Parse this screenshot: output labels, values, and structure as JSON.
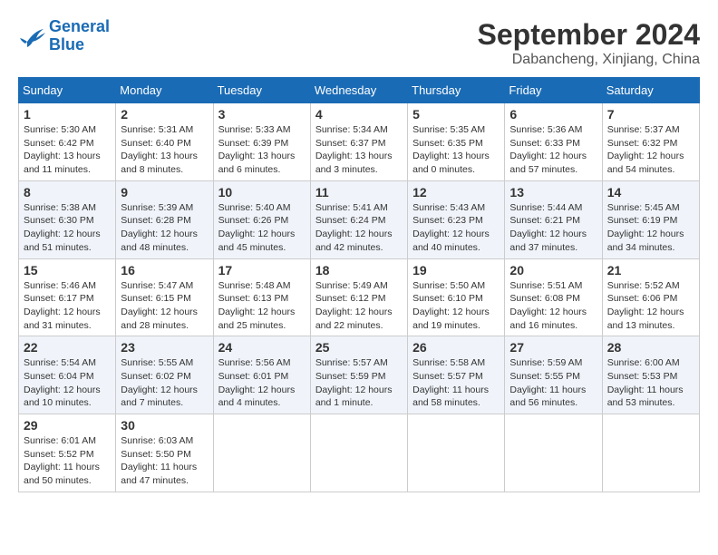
{
  "logo": {
    "line1": "General",
    "line2": "Blue"
  },
  "title": "September 2024",
  "location": "Dabancheng, Xinjiang, China",
  "weekdays": [
    "Sunday",
    "Monday",
    "Tuesday",
    "Wednesday",
    "Thursday",
    "Friday",
    "Saturday"
  ],
  "weeks": [
    [
      {
        "day": "1",
        "info": "Sunrise: 5:30 AM\nSunset: 6:42 PM\nDaylight: 13 hours\nand 11 minutes."
      },
      {
        "day": "2",
        "info": "Sunrise: 5:31 AM\nSunset: 6:40 PM\nDaylight: 13 hours\nand 8 minutes."
      },
      {
        "day": "3",
        "info": "Sunrise: 5:33 AM\nSunset: 6:39 PM\nDaylight: 13 hours\nand 6 minutes."
      },
      {
        "day": "4",
        "info": "Sunrise: 5:34 AM\nSunset: 6:37 PM\nDaylight: 13 hours\nand 3 minutes."
      },
      {
        "day": "5",
        "info": "Sunrise: 5:35 AM\nSunset: 6:35 PM\nDaylight: 13 hours\nand 0 minutes."
      },
      {
        "day": "6",
        "info": "Sunrise: 5:36 AM\nSunset: 6:33 PM\nDaylight: 12 hours\nand 57 minutes."
      },
      {
        "day": "7",
        "info": "Sunrise: 5:37 AM\nSunset: 6:32 PM\nDaylight: 12 hours\nand 54 minutes."
      }
    ],
    [
      {
        "day": "8",
        "info": "Sunrise: 5:38 AM\nSunset: 6:30 PM\nDaylight: 12 hours\nand 51 minutes."
      },
      {
        "day": "9",
        "info": "Sunrise: 5:39 AM\nSunset: 6:28 PM\nDaylight: 12 hours\nand 48 minutes."
      },
      {
        "day": "10",
        "info": "Sunrise: 5:40 AM\nSunset: 6:26 PM\nDaylight: 12 hours\nand 45 minutes."
      },
      {
        "day": "11",
        "info": "Sunrise: 5:41 AM\nSunset: 6:24 PM\nDaylight: 12 hours\nand 42 minutes."
      },
      {
        "day": "12",
        "info": "Sunrise: 5:43 AM\nSunset: 6:23 PM\nDaylight: 12 hours\nand 40 minutes."
      },
      {
        "day": "13",
        "info": "Sunrise: 5:44 AM\nSunset: 6:21 PM\nDaylight: 12 hours\nand 37 minutes."
      },
      {
        "day": "14",
        "info": "Sunrise: 5:45 AM\nSunset: 6:19 PM\nDaylight: 12 hours\nand 34 minutes."
      }
    ],
    [
      {
        "day": "15",
        "info": "Sunrise: 5:46 AM\nSunset: 6:17 PM\nDaylight: 12 hours\nand 31 minutes."
      },
      {
        "day": "16",
        "info": "Sunrise: 5:47 AM\nSunset: 6:15 PM\nDaylight: 12 hours\nand 28 minutes."
      },
      {
        "day": "17",
        "info": "Sunrise: 5:48 AM\nSunset: 6:13 PM\nDaylight: 12 hours\nand 25 minutes."
      },
      {
        "day": "18",
        "info": "Sunrise: 5:49 AM\nSunset: 6:12 PM\nDaylight: 12 hours\nand 22 minutes."
      },
      {
        "day": "19",
        "info": "Sunrise: 5:50 AM\nSunset: 6:10 PM\nDaylight: 12 hours\nand 19 minutes."
      },
      {
        "day": "20",
        "info": "Sunrise: 5:51 AM\nSunset: 6:08 PM\nDaylight: 12 hours\nand 16 minutes."
      },
      {
        "day": "21",
        "info": "Sunrise: 5:52 AM\nSunset: 6:06 PM\nDaylight: 12 hours\nand 13 minutes."
      }
    ],
    [
      {
        "day": "22",
        "info": "Sunrise: 5:54 AM\nSunset: 6:04 PM\nDaylight: 12 hours\nand 10 minutes."
      },
      {
        "day": "23",
        "info": "Sunrise: 5:55 AM\nSunset: 6:02 PM\nDaylight: 12 hours\nand 7 minutes."
      },
      {
        "day": "24",
        "info": "Sunrise: 5:56 AM\nSunset: 6:01 PM\nDaylight: 12 hours\nand 4 minutes."
      },
      {
        "day": "25",
        "info": "Sunrise: 5:57 AM\nSunset: 5:59 PM\nDaylight: 12 hours\nand 1 minute."
      },
      {
        "day": "26",
        "info": "Sunrise: 5:58 AM\nSunset: 5:57 PM\nDaylight: 11 hours\nand 58 minutes."
      },
      {
        "day": "27",
        "info": "Sunrise: 5:59 AM\nSunset: 5:55 PM\nDaylight: 11 hours\nand 56 minutes."
      },
      {
        "day": "28",
        "info": "Sunrise: 6:00 AM\nSunset: 5:53 PM\nDaylight: 11 hours\nand 53 minutes."
      }
    ],
    [
      {
        "day": "29",
        "info": "Sunrise: 6:01 AM\nSunset: 5:52 PM\nDaylight: 11 hours\nand 50 minutes."
      },
      {
        "day": "30",
        "info": "Sunrise: 6:03 AM\nSunset: 5:50 PM\nDaylight: 11 hours\nand 47 minutes."
      },
      {
        "day": "",
        "info": ""
      },
      {
        "day": "",
        "info": ""
      },
      {
        "day": "",
        "info": ""
      },
      {
        "day": "",
        "info": ""
      },
      {
        "day": "",
        "info": ""
      }
    ]
  ]
}
